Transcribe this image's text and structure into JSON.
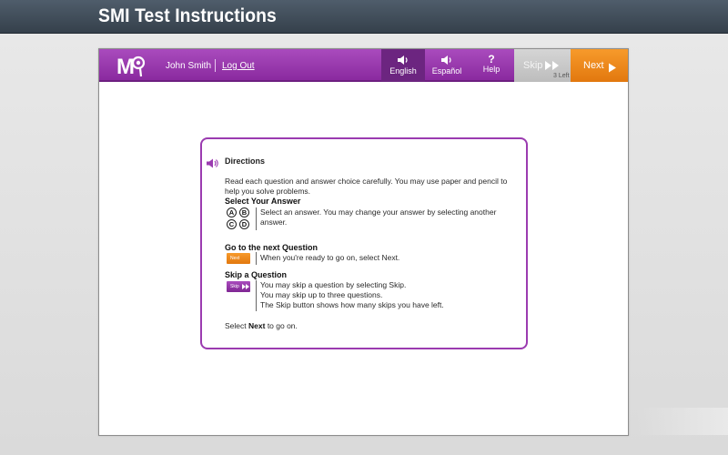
{
  "page": {
    "title": "SMI Test Instructions"
  },
  "toolbar": {
    "logo_letter": "M",
    "user_name": "John Smith",
    "logout_label": "Log Out",
    "english_label": "English",
    "espanol_label": "Español",
    "help_glyph": "?",
    "help_label": "Help",
    "skip_label": "Skip",
    "skips_left": "3 Left",
    "next_label": "Next",
    "icons": [
      "speaker-icon",
      "speaker-icon",
      "question-mark-icon",
      "double-arrow-icon",
      "play-arrow-icon"
    ]
  },
  "directions": {
    "heading": "Directions",
    "intro": "Read each question and answer choice carefully. You may use paper and pencil to help you solve problems.",
    "select_heading": "Select Your Answer",
    "answer_letters": [
      "A",
      "B",
      "C",
      "D"
    ],
    "select_desc": "Select an answer. You may change your answer by selecting another answer.",
    "next_heading": "Go to the next Question",
    "mini_next_label": "Next",
    "next_desc": "When you're ready to go on, select Next.",
    "skip_heading": "Skip a Question",
    "mini_skip_label": "Skip",
    "skip_desc_1": "You may skip a question by selecting Skip.",
    "skip_desc_2": "You may skip up to three questions.",
    "skip_desc_3": "The Skip button shows how many skips you have left.",
    "go_on_prefix": "Select",
    "go_on_bold": "Next",
    "go_on_suffix": "to go on."
  },
  "colors": {
    "toolbar_purple": "#9b3bb0",
    "english_active": "#6c2580",
    "next_orange": "#f08a1e",
    "skip_gray": "#c8c8c8",
    "header_slate": "#414d59"
  }
}
